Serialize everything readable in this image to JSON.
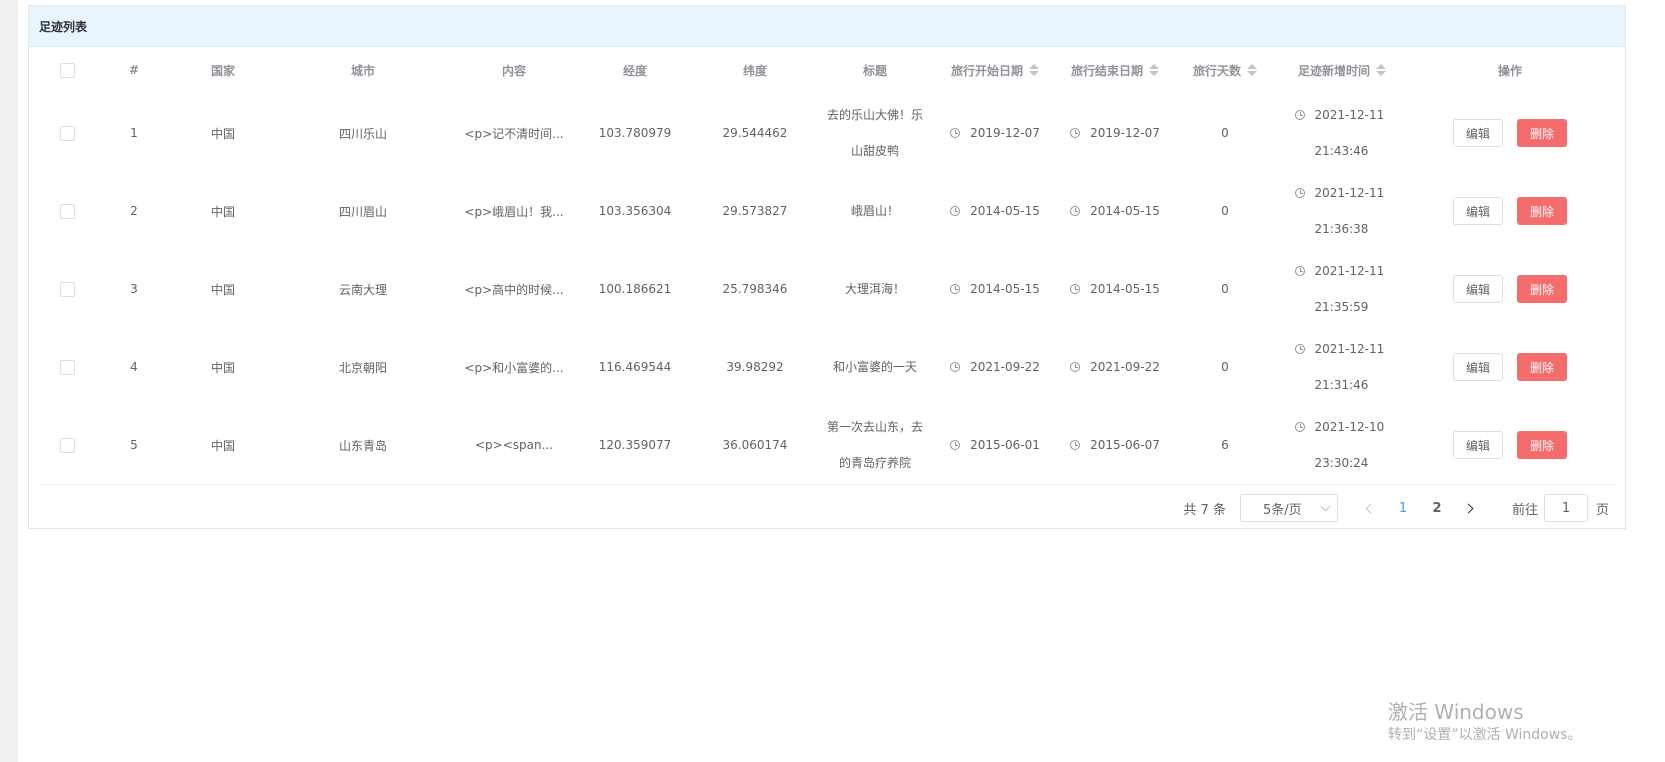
{
  "card": {
    "title": "足迹列表"
  },
  "table": {
    "headers": {
      "num": "#",
      "country": "国家",
      "city": "城市",
      "content": "内容",
      "lng": "经度",
      "lat": "纬度",
      "title": "标题",
      "start": "旅行开始日期",
      "end": "旅行结束日期",
      "days": "旅行天数",
      "addtime": "足迹新增时间",
      "ops": "操作"
    },
    "rows": [
      {
        "num": "1",
        "country": "中国",
        "city": "四川乐山",
        "content": "<p>记不清时间...",
        "lng": "103.780979",
        "lat": "29.544462",
        "title": "去的乐山大佛！乐山甜皮鸭",
        "start": "2019-12-07",
        "end": "2019-12-07",
        "days": "0",
        "addtime": "2021-12-11 21:43:46"
      },
      {
        "num": "2",
        "country": "中国",
        "city": "四川眉山",
        "content": "<p>峨眉山！我...",
        "lng": "103.356304",
        "lat": "29.573827",
        "title": "峨眉山！",
        "start": "2014-05-15",
        "end": "2014-05-15",
        "days": "0",
        "addtime": "2021-12-11 21:36:38"
      },
      {
        "num": "3",
        "country": "中国",
        "city": "云南大理",
        "content": "<p>高中的时候...",
        "lng": "100.186621",
        "lat": "25.798346",
        "title": "大理洱海！",
        "start": "2014-05-15",
        "end": "2014-05-15",
        "days": "0",
        "addtime": "2021-12-11 21:35:59"
      },
      {
        "num": "4",
        "country": "中国",
        "city": "北京朝阳",
        "content": "<p>和小富婆的...",
        "lng": "116.469544",
        "lat": "39.98292",
        "title": "和小富婆的一天",
        "start": "2021-09-22",
        "end": "2021-09-22",
        "days": "0",
        "addtime": "2021-12-11 21:31:46"
      },
      {
        "num": "5",
        "country": "中国",
        "city": "山东青岛",
        "content": "<p><span...",
        "lng": "120.359077",
        "lat": "36.060174",
        "title": "第一次去山东，去的青岛疗养院",
        "start": "2015-06-01",
        "end": "2015-06-07",
        "days": "6",
        "addtime": "2021-12-10 23:30:24"
      }
    ],
    "edit_label": "编辑",
    "delete_label": "删除"
  },
  "pagination": {
    "total": "共 7 条",
    "page_size": "5条/页",
    "pages": [
      "1",
      "2"
    ],
    "current_page": "1",
    "goto_label": "前往",
    "goto_value": "1",
    "page_suffix": "页"
  },
  "watermark": {
    "line1": "激活 Windows",
    "line2": "转到“设置”以激活 Windows。"
  }
}
